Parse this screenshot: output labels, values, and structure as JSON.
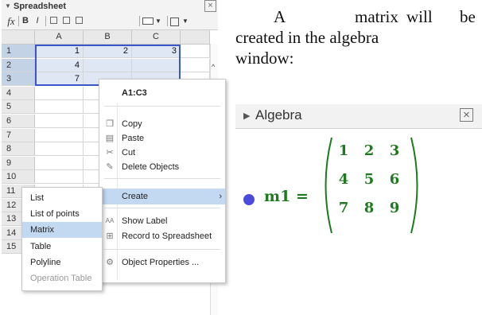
{
  "spreadsheet": {
    "title": "Spreadsheet",
    "close": "×",
    "toolbar": {
      "fx": "fx",
      "bold": "B",
      "italic": "I"
    },
    "columns": [
      "A",
      "B",
      "C"
    ],
    "rows": [
      {
        "num": "1",
        "cells": [
          "1",
          "2",
          "3"
        ]
      },
      {
        "num": "2",
        "cells": [
          "4",
          "",
          ""
        ]
      },
      {
        "num": "3",
        "cells": [
          "7",
          "",
          ""
        ]
      },
      {
        "num": "4",
        "cells": [
          "",
          "",
          ""
        ]
      },
      {
        "num": "5",
        "cells": [
          "",
          "",
          ""
        ]
      },
      {
        "num": "6",
        "cells": [
          "",
          "",
          ""
        ]
      },
      {
        "num": "7",
        "cells": [
          "",
          "",
          ""
        ]
      },
      {
        "num": "8",
        "cells": [
          "",
          "",
          ""
        ]
      },
      {
        "num": "9",
        "cells": [
          "",
          "",
          ""
        ]
      },
      {
        "num": "10",
        "cells": [
          "",
          "",
          ""
        ]
      },
      {
        "num": "11",
        "cells": [
          "",
          "",
          ""
        ]
      },
      {
        "num": "12",
        "cells": [
          "",
          "",
          ""
        ]
      },
      {
        "num": "13",
        "cells": [
          "",
          "",
          ""
        ]
      },
      {
        "num": "14",
        "cells": [
          "",
          "",
          ""
        ]
      },
      {
        "num": "15",
        "cells": [
          "",
          "",
          ""
        ]
      }
    ]
  },
  "context_menu": {
    "title": "A1:C3",
    "items": [
      {
        "label": "Copy",
        "icon": "copy-icon"
      },
      {
        "label": "Paste",
        "icon": "paste-icon"
      },
      {
        "label": "Cut",
        "icon": "cut-icon"
      },
      {
        "label": "Delete Objects",
        "icon": "eraser-icon"
      },
      {
        "label": "Create",
        "icon": "",
        "submenu_arrow": "›"
      },
      {
        "label": "Show Label",
        "icon": "label-icon"
      },
      {
        "label": "Record to Spreadsheet",
        "icon": "grid-icon"
      },
      {
        "label": "Object Properties ...",
        "icon": "gear-icon"
      }
    ]
  },
  "create_submenu": {
    "items": [
      "List",
      "List of points",
      "Matrix",
      "Table",
      "Polyline",
      "Operation Table"
    ],
    "highlighted": "Matrix",
    "disabled": [
      "Operation Table"
    ]
  },
  "paragraph": {
    "line1_words": [
      "A",
      "matrix",
      "will",
      "be"
    ],
    "line2": "created in the algebra",
    "line3": "window:"
  },
  "algebra": {
    "title": "Algebra",
    "close": "×",
    "label": "m1 =",
    "matrix": [
      [
        "1",
        "2",
        "3"
      ],
      [
        "4",
        "5",
        "6"
      ],
      [
        "7",
        "8",
        "9"
      ]
    ],
    "dot_color": "#4a4adb",
    "text_color": "#1e7a1e"
  },
  "colors": {
    "selection_border": "#3a56c8",
    "menu_highlight": "#c3d9f2"
  }
}
